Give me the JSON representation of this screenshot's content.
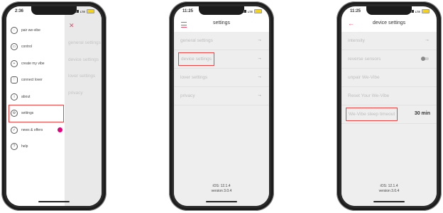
{
  "phone1": {
    "time": "2:36",
    "network": "LTE",
    "menu": [
      {
        "label": "pair we-vibe",
        "icon": "vibe-icon"
      },
      {
        "label": "control",
        "icon": "gamepad-icon"
      },
      {
        "label": "create my vibe",
        "icon": "plus-icon"
      },
      {
        "label": "connect lover",
        "icon": "people-icon"
      },
      {
        "label": "about",
        "icon": "info-icon"
      },
      {
        "label": "settings",
        "icon": "gear-icon"
      },
      {
        "label": "news & offers",
        "icon": "checkmark-icon"
      },
      {
        "label": "help",
        "icon": "question-icon"
      }
    ],
    "panel_items": [
      "general settings",
      "device settings",
      "lover settings",
      "privacy"
    ],
    "accent": "#e94b6a",
    "badge_color": "#e6007e"
  },
  "phone2": {
    "time": "11:25",
    "network": "LTE",
    "title": "settings",
    "items": [
      "general settings",
      "device settings",
      "lover settings",
      "privacy"
    ],
    "footer_os": "iOS: 12.1.4",
    "footer_version": "version 3.0.4"
  },
  "phone3": {
    "time": "11:25",
    "network": "LTE",
    "title": "device settings",
    "items": {
      "intensity": "intensity",
      "reverse": "reverse sensors",
      "unpair": "unpair We-Vibe",
      "reset": "Reset Your We-Vibe",
      "sleep": "We-Vibe sleep timeout",
      "sleep_value": "30 min"
    },
    "footer_os": "iOS: 12.1.4",
    "footer_version": "version 3.0.4"
  }
}
